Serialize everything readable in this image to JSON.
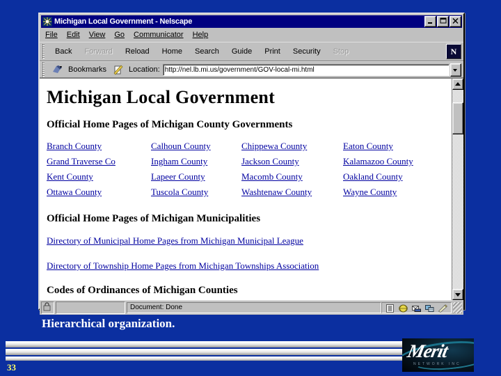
{
  "slide": {
    "caption": "Hierarchical organization.",
    "page_number": "33",
    "background_color": "#0b2fa0",
    "logo": {
      "mark": "Merit",
      "subtitle": "NETWORK INC"
    }
  },
  "browser": {
    "title": "Michigan Local Government - Nelscape",
    "title_icon": "netscape-ship-icon",
    "window_buttons": {
      "minimize": "_",
      "maximize": "□",
      "close": "✕"
    },
    "menu": [
      {
        "label": "File",
        "accel": "F"
      },
      {
        "label": "Edit",
        "accel": "E"
      },
      {
        "label": "View",
        "accel": "V"
      },
      {
        "label": "Go",
        "accel": "G"
      },
      {
        "label": "Communicator",
        "accel": "C"
      },
      {
        "label": "Help",
        "accel": "H"
      }
    ],
    "toolbar": [
      {
        "label": "Back",
        "disabled": false
      },
      {
        "label": "Forward",
        "disabled": true
      },
      {
        "label": "Reload",
        "disabled": false
      },
      {
        "label": "Home",
        "disabled": false
      },
      {
        "label": "Search",
        "disabled": false
      },
      {
        "label": "Guide",
        "disabled": false
      },
      {
        "label": "Print",
        "disabled": false
      },
      {
        "label": "Security",
        "disabled": false
      },
      {
        "label": "Stop",
        "disabled": true
      }
    ],
    "toolbar_logo": "N",
    "location": {
      "bookmarks_label": "Bookmarks",
      "bookmarks_icon": "bookmark-icon",
      "location_label": "Location:",
      "location_icon": "page-quill-icon",
      "url": "http://nel.lb.mi.us/government/GOV-local-mi.html",
      "dropdown_icon": "chevron-down-icon"
    },
    "statusbar": {
      "lock_icon": "padlock-icon",
      "message": "Document: Done",
      "icons": [
        "navigator-list-icon",
        "globe-icon",
        "mail-icon",
        "newsgroup-icon",
        "composer-pencil-icon"
      ],
      "resize_grip": "resize-grip-icon"
    },
    "scrollbar": {
      "up_icon": "scroll-up-arrow-icon",
      "down_icon": "scroll-down-arrow-icon"
    }
  },
  "page": {
    "h1": "Michigan Local Government",
    "sections": [
      {
        "heading": "Official Home Pages of Michigan County Governments",
        "links": [
          "Branch County",
          "Calhoun County",
          "Chippewa County",
          "Eaton County",
          "Grand Traverse Co",
          "Ingham County",
          "Jackson County",
          "Kalamazoo County",
          "Kent County",
          "Lapeer County",
          "Macomb County",
          "Oakland County",
          "Ottawa County",
          "Tuscola County",
          "Washtenaw County",
          "Wayne County"
        ]
      },
      {
        "heading": "Official Home Pages of Michigan Municipalities",
        "links": [
          "Directory of Municipal Home Pages from Michigan Municipal League",
          "Directory of Township Home Pages from Michigan Townships Association"
        ]
      },
      {
        "heading": "Codes of Ordinances of Michigan Counties",
        "links": []
      }
    ],
    "link_color": "#0000A0"
  }
}
